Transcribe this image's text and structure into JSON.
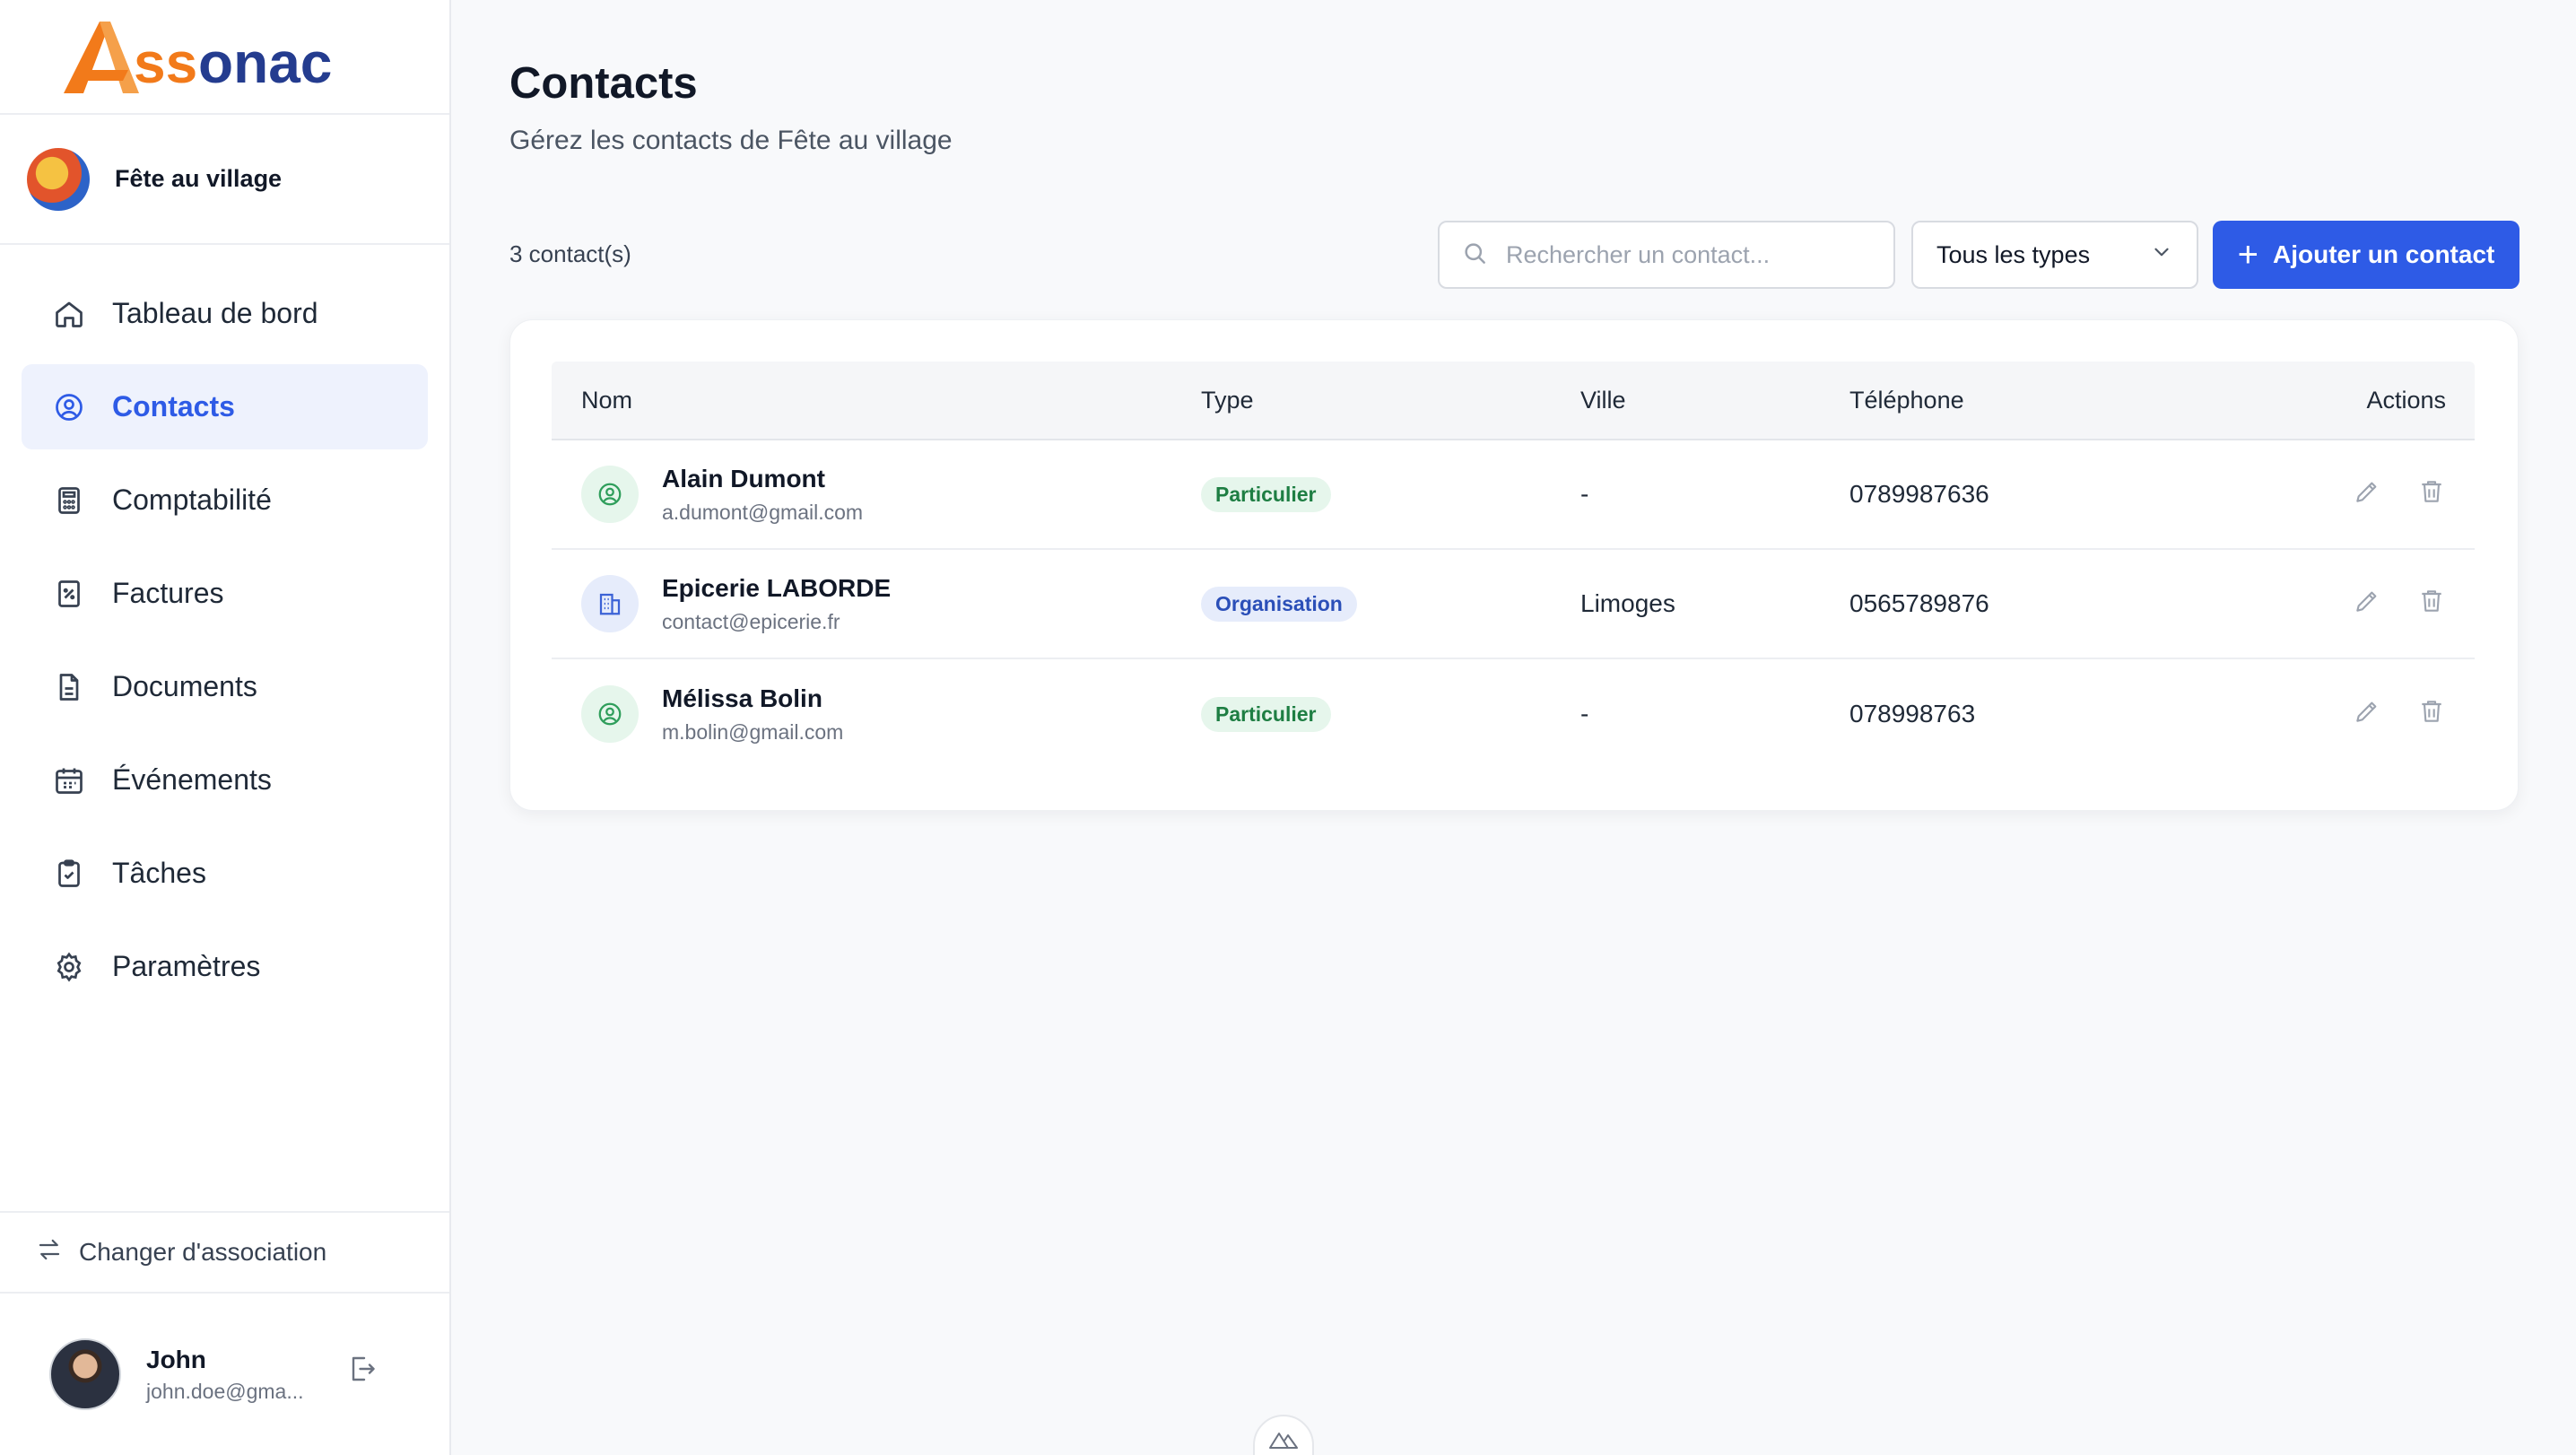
{
  "brand": {
    "name": "Assonac",
    "accent": "#f27a1a",
    "text_color": "#243c8f"
  },
  "association": {
    "name": "Fête au village"
  },
  "sidebar": {
    "items": [
      {
        "label": "Tableau de bord",
        "icon": "home-icon"
      },
      {
        "label": "Contacts",
        "icon": "user-circle-icon",
        "active": true
      },
      {
        "label": "Comptabilité",
        "icon": "calculator-icon"
      },
      {
        "label": "Factures",
        "icon": "receipt-icon"
      },
      {
        "label": "Documents",
        "icon": "document-icon"
      },
      {
        "label": "Événements",
        "icon": "calendar-icon"
      },
      {
        "label": "Tâches",
        "icon": "clipboard-check-icon"
      },
      {
        "label": "Paramètres",
        "icon": "gear-icon"
      }
    ],
    "switch_label": "Changer d'association"
  },
  "user": {
    "name": "John",
    "email": "john.doe@gma..."
  },
  "page": {
    "title": "Contacts",
    "subtitle": "Gérez les contacts de Fête au village",
    "count": "3 contact(s)"
  },
  "toolbar": {
    "search_placeholder": "Rechercher un contact...",
    "type_filter": "Tous les types",
    "add_label": "Ajouter un contact"
  },
  "table": {
    "columns": [
      "Nom",
      "Type",
      "Ville",
      "Téléphone",
      "Actions"
    ],
    "rows": [
      {
        "name": "Alain Dumont",
        "email": "a.dumont@gmail.com",
        "type": "Particulier",
        "kind": "person",
        "city": "-",
        "phone": "0789987636"
      },
      {
        "name": "Epicerie LABORDE",
        "email": "contact@epicerie.fr",
        "type": "Organisation",
        "kind": "org",
        "city": "Limoges",
        "phone": "0565789876"
      },
      {
        "name": "Mélissa Bolin",
        "email": "m.bolin@gmail.com",
        "type": "Particulier",
        "kind": "person",
        "city": "-",
        "phone": "078998763"
      }
    ]
  },
  "colors": {
    "primary": "#2e5be6",
    "particulier": "#1e7e43",
    "organisation": "#2b4fb8"
  }
}
